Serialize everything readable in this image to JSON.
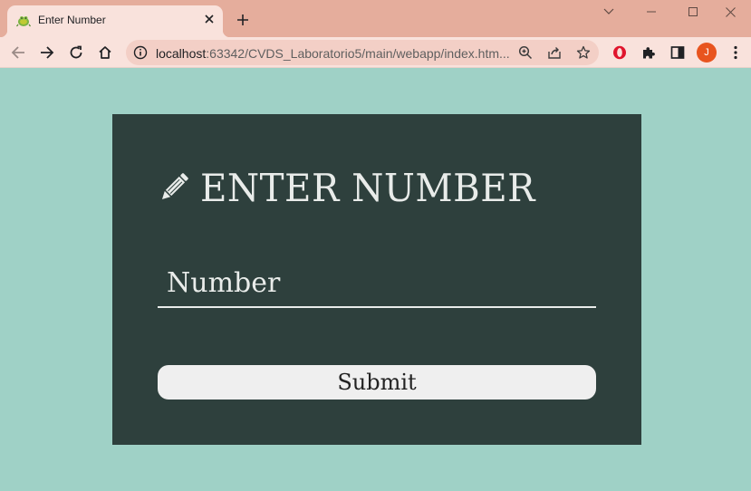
{
  "browser": {
    "tab": {
      "title": "Enter Number",
      "favicon": "android-bug-icon"
    },
    "address_bar": {
      "url_host": "localhost",
      "url_rest": ":63342/CVDS_Laboratorio5/main/webapp/index.htm..."
    },
    "profile_initial": "J",
    "colors": {
      "titlebar": "#e5ad9c",
      "toolbar": "#f9e2dc",
      "omnibox": "#f3cfc6",
      "avatar": "#e8541e"
    }
  },
  "page": {
    "heading": "ENTER NUMBER",
    "heading_icon": "pencil-icon",
    "input": {
      "placeholder": "Number",
      "value": ""
    },
    "submit_label": "Submit",
    "colors": {
      "background": "#9fd1c6",
      "card": "#2e403d",
      "text": "#e9ecea",
      "button": "#efefef"
    }
  }
}
